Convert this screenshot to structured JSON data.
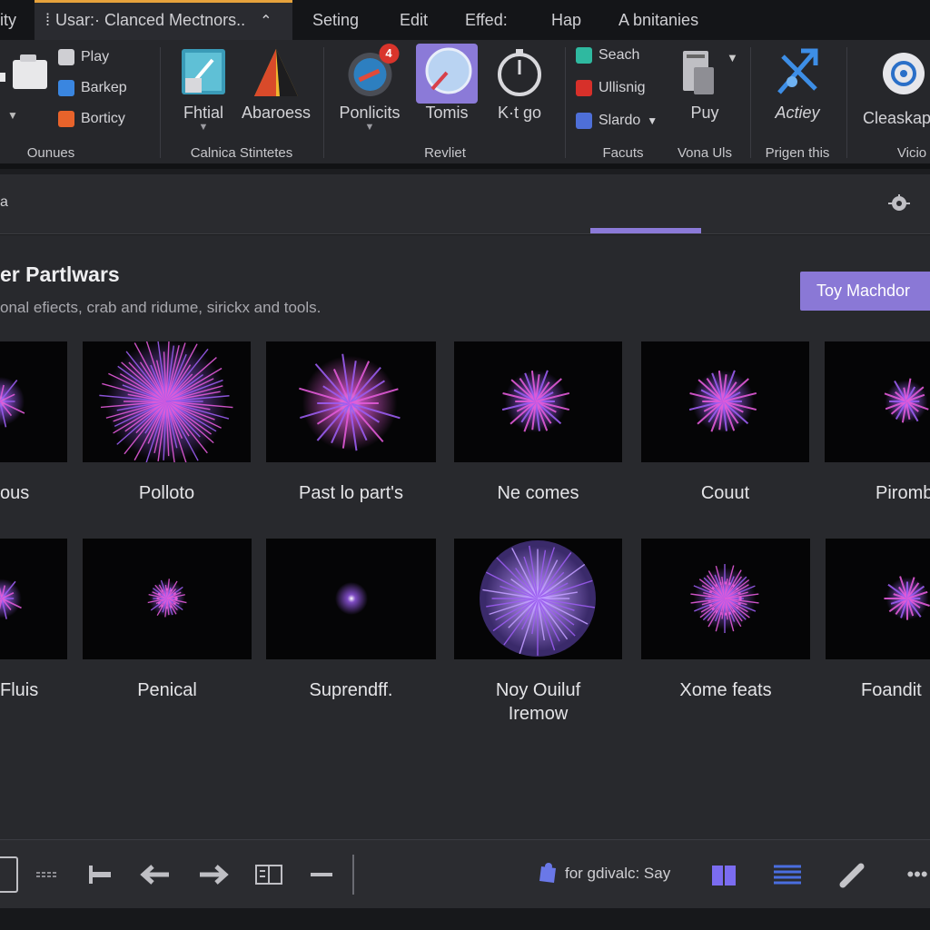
{
  "topbar": {
    "tabs": [
      {
        "label": "ity"
      },
      {
        "label": "Usar:· Clanced Mectnors.."
      },
      {
        "label": "Seting"
      },
      {
        "label": "Edit"
      },
      {
        "label": "Effed:"
      },
      {
        "label": "Hap"
      },
      {
        "label": "A bnitanies"
      }
    ]
  },
  "ribbon": {
    "groups": {
      "g1": "Ounues",
      "g2": "Calnica Stintetes",
      "g3": "Revliet",
      "g4": "Facuts",
      "g5": "Vona Uls",
      "g6": "Prigen this",
      "g7": "Vicio"
    },
    "small_items": {
      "play": "Play",
      "barkep": "Barkep",
      "bortiсy": "Borticy",
      "seach": "Seach",
      "ullisnig": "Ullisnig",
      "stardo": "Slardo"
    },
    "buttons": {
      "fhtial": "Fhtial",
      "abaroess": "Abaroess",
      "poniicits": "Ponlicits",
      "tomis": "Tomis",
      "ktgo": "K·t go",
      "puy": "Puy",
      "actiey": "Actiey",
      "cleaskap": "Cleaskap"
    },
    "badge_count": "4"
  },
  "section": {
    "title": "er Partlwars",
    "description": "onal efiects, crab and ridume, sirickx and tools.",
    "cta_label": "Toy Machdor"
  },
  "grid": {
    "row1": [
      "ous",
      "Polloto",
      "Past lo part's",
      "Ne comes",
      "Couut",
      "Piromb"
    ],
    "row2": [
      "Fluis",
      "Penical",
      "Suprendff.",
      "Noy Ouiluf\nIremow",
      "Xome feats",
      "Foandit"
    ]
  },
  "bottombar": {
    "status_text": "for gdivalc: Say"
  },
  "colors": {
    "accent": "#8a78d6",
    "active_tab_top": "#e6a23c",
    "particle_pink": "#e15ad8",
    "particle_purple": "#9a5cf0"
  }
}
